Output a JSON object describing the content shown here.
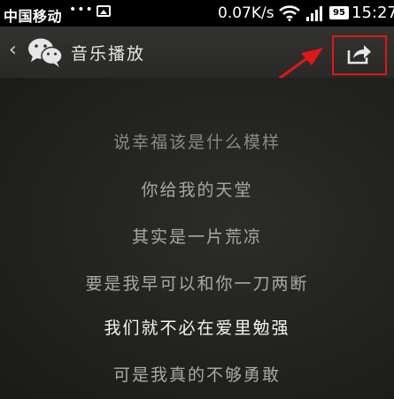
{
  "status_bar": {
    "carrier": "中国移动",
    "dots": "•••",
    "network_speed": "0.07K/s",
    "battery_level": "95",
    "time": "15:27",
    "icons": [
      "image-notification-icon",
      "wifi-icon",
      "signal-icon",
      "battery-icon"
    ]
  },
  "header": {
    "back_icon": "‹",
    "title": "音乐播放",
    "app_icon": "wechat-icon",
    "share_icon": "share-icon",
    "highlight_color": "#e01818"
  },
  "lyrics": [
    "说幸福该是什么模样",
    "你给我的天堂",
    "其实是一片荒凉",
    "要是我早可以和你一刀两断",
    "我们就不必在爱里勉强",
    "可是我真的不够勇敢"
  ]
}
